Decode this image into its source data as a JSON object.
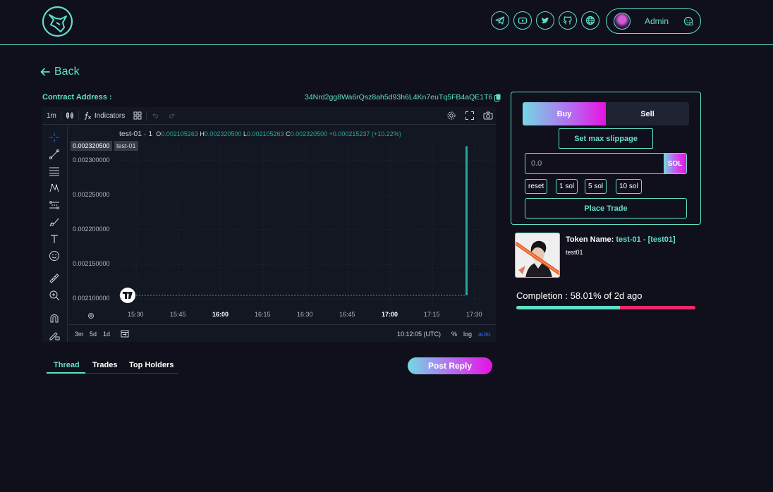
{
  "header": {
    "socials": [
      {
        "icon": "telegram-icon"
      },
      {
        "icon": "youtube-icon"
      },
      {
        "icon": "twitter-icon"
      },
      {
        "icon": "github-icon"
      },
      {
        "icon": "globe-icon"
      }
    ],
    "user": {
      "name": "Admin"
    }
  },
  "nav": {
    "back_label": "Back"
  },
  "contract": {
    "label": "Contract Address :",
    "address": "34Nrd2gg8Wa6rQsz8ah5d93h6L4Kn7euTq5FB4aQE1T6"
  },
  "chart_toolbar": {
    "interval": "1m",
    "indicators_label": "Indicators"
  },
  "chart_data": {
    "type": "line",
    "symbol_title": "test-01 · 1",
    "ohlc": {
      "o_label": "O",
      "o": "0.002105263",
      "h_label": "H",
      "h": "0.002320500",
      "l_label": "L",
      "l": "0.002105263",
      "c_label": "C",
      "c": "0.002320500",
      "change": "+0.000215237 (+10.22%)"
    },
    "last_price_label": "0.002320500",
    "symbol_tag": "test-01",
    "y_ticks": [
      "0.002300000",
      "0.002250000",
      "0.002200000",
      "0.002150000",
      "0.002100000"
    ],
    "y_tick_values": [
      0.0023,
      0.00225,
      0.0022,
      0.00215,
      0.0021
    ],
    "x_ticks": [
      "15:30",
      "15:45",
      "16:00",
      "16:15",
      "16:30",
      "16:45",
      "17:00",
      "17:15",
      "17:30"
    ],
    "bold_x_ticks": [
      "16:00",
      "17:00"
    ],
    "ylim": [
      0.002092,
      0.002324
    ],
    "series": [
      {
        "values": [
          0.002105263,
          0.002105263,
          0.002105263,
          0.002105263,
          0.002105263,
          0.002105263,
          0.002105263,
          0.002105263,
          0.0023205
        ]
      }
    ],
    "colors": {
      "line": "#26a69a",
      "grid": "#1f2433"
    }
  },
  "chart_bottom": {
    "ranges": [
      "3m",
      "5d",
      "1d"
    ],
    "time": "10:12:05 (UTC)",
    "percent": "%",
    "log": "log",
    "auto": "auto"
  },
  "tabs": [
    {
      "label": "Thread",
      "active": true
    },
    {
      "label": "Trades",
      "active": false
    },
    {
      "label": "Top Holders",
      "active": false
    }
  ],
  "post_reply_label": "Post Reply",
  "trade": {
    "buy_label": "Buy",
    "sell_label": "Sell",
    "slippage_label": "Set max slippage",
    "amount_placeholder": "0.0",
    "currency": "SOL",
    "quick_buttons": [
      "reset",
      "1 sol",
      "5 sol",
      "10 sol"
    ],
    "place_label": "Place Trade"
  },
  "token": {
    "name_label": "Token Name:",
    "name_value": "test-01 - [test01]",
    "description": "test01"
  },
  "completion": {
    "text": "Completion : 58.01% of 2d ago",
    "percent": 58.01
  },
  "colors": {
    "accent": "#5fe0c9",
    "danger": "#ea2a6a",
    "background": "#10101c"
  }
}
